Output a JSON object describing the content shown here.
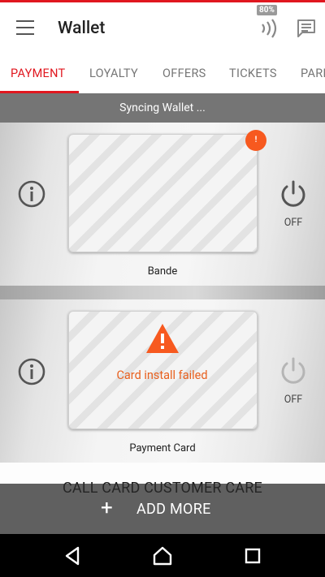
{
  "app": {
    "title": "Wallet",
    "battery_badge": "80%"
  },
  "tabs": [
    {
      "label": "PAYMENT"
    },
    {
      "label": "LOYALTY"
    },
    {
      "label": "OFFERS"
    },
    {
      "label": "TICKETS"
    },
    {
      "label": "PARKING"
    }
  ],
  "sync_status": "Syncing Wallet ...",
  "cards": [
    {
      "name": "Bande",
      "power_state": "OFF",
      "error_badge": "!"
    },
    {
      "name": "Payment Card",
      "power_state": "OFF",
      "status_message": "Card install failed"
    }
  ],
  "footer": {
    "call_care_label": "CALL CARD CUSTOMER CARE",
    "add_more_label": "ADD MORE",
    "add_more_icon": "+"
  },
  "icons": {
    "menu": "menu-icon",
    "nfc": "nfc-icon",
    "message": "message-icon",
    "info": "info-icon",
    "power": "power-icon",
    "warning": "warning-icon"
  },
  "colors": {
    "brand": "#e0171f",
    "warning": "#f7591f",
    "sync_bar": "#757575"
  }
}
